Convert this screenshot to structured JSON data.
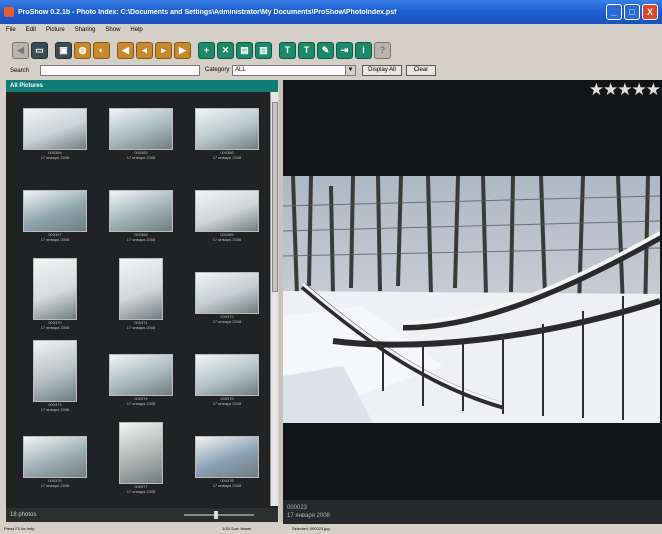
{
  "window": {
    "title": "ProShow 0.2.1b - Photo Index: C:\\Documents and Settings\\Administrator\\My Documents\\ProShow\\PhotoIndex.psf",
    "controls": [
      "_",
      "□",
      "X"
    ]
  },
  "menu": [
    "File",
    "Edit",
    "Picture",
    "Sharing",
    "Show",
    "Help"
  ],
  "toolbar": {
    "buttons": [
      {
        "icon": "nav-first-icon",
        "glyph": "◀",
        "style": "gray"
      },
      {
        "icon": "print-icon",
        "glyph": "▭",
        "style": "dark"
      },
      {
        "icon": "slideshow-icon",
        "glyph": "▣",
        "style": "dark"
      },
      {
        "icon": "zoom-icon",
        "glyph": "◍",
        "style": "orange"
      },
      {
        "icon": "rotate-icon",
        "glyph": "◐",
        "style": "orange"
      },
      {
        "icon": "first-icon",
        "glyph": "◀",
        "style": "orange"
      },
      {
        "icon": "prev-icon",
        "glyph": "◂",
        "style": "orange"
      },
      {
        "icon": "next-icon",
        "glyph": "▸",
        "style": "orange"
      },
      {
        "icon": "last-icon",
        "glyph": "▶",
        "style": "orange"
      },
      {
        "icon": "add-icon",
        "glyph": "+",
        "style": "green"
      },
      {
        "icon": "delete-icon",
        "glyph": "✕",
        "style": "green"
      },
      {
        "icon": "copy-icon",
        "glyph": "▤",
        "style": "green"
      },
      {
        "icon": "move-icon",
        "glyph": "▥",
        "style": "green"
      },
      {
        "icon": "text-icon",
        "glyph": "T",
        "style": "green"
      },
      {
        "icon": "caption-icon",
        "glyph": "T",
        "style": "green"
      },
      {
        "icon": "edit-icon",
        "glyph": "✎",
        "style": "green"
      },
      {
        "icon": "export-icon",
        "glyph": "⇥",
        "style": "green"
      },
      {
        "icon": "info-icon",
        "glyph": "i",
        "style": "green"
      },
      {
        "icon": "help-icon",
        "glyph": "?",
        "style": "gray"
      }
    ]
  },
  "search": {
    "label": "Search",
    "value": "",
    "category_label": "Category",
    "category_value": "ALL",
    "display_all": "Display All",
    "clear": "Clear"
  },
  "panel": {
    "header": "All Pictures",
    "footer": "18 photos",
    "zoom_level": 0.45
  },
  "thumbnails": [
    {
      "id": "000364",
      "date": "17 января 2008",
      "tone": "#c9d3d6",
      "portrait": false
    },
    {
      "id": "000365",
      "date": "17 января 2008",
      "tone": "#a6bac0",
      "portrait": false
    },
    {
      "id": "000366",
      "date": "17 января 2008",
      "tone": "#b9c7c9",
      "portrait": false
    },
    {
      "id": "000367",
      "date": "17 января 2008",
      "tone": "#8ea6ac",
      "portrait": false
    },
    {
      "id": "000368",
      "date": "17 января 2008",
      "tone": "#9fb3b6",
      "portrait": false
    },
    {
      "id": "000369",
      "date": "17 января 2008",
      "tone": "#cfd5d6",
      "portrait": false
    },
    {
      "id": "000370",
      "date": "17 января 2008",
      "tone": "#d8dcdc",
      "portrait": true
    },
    {
      "id": "000371",
      "date": "17 января 2008",
      "tone": "#d5d8d8",
      "portrait": true
    },
    {
      "id": "000372",
      "date": "17 января 2008",
      "tone": "#c4cdd0",
      "portrait": false
    },
    {
      "id": "000373",
      "date": "17 января 2008",
      "tone": "#b7c1c4",
      "portrait": true
    },
    {
      "id": "000374",
      "date": "17 января 2008",
      "tone": "#a9b9bd",
      "portrait": false
    },
    {
      "id": "000375",
      "date": "17 января 2008",
      "tone": "#b3c2c6",
      "portrait": false
    },
    {
      "id": "000376",
      "date": "17 января 2008",
      "tone": "#9db0b5",
      "portrait": false
    },
    {
      "id": "000377",
      "date": "17 января 2008",
      "tone": "#b1b3b1",
      "portrait": true
    },
    {
      "id": "000378",
      "date": "17 января 2008",
      "tone": "#8aa0b4",
      "portrait": false
    }
  ],
  "viewer": {
    "rating": "★★★★★",
    "photo_id": "000023",
    "photo_date": "17 января 2008"
  },
  "statusbar": {
    "left": "Press F1 for help",
    "middle": "1/18    Sort: Name",
    "right": "Selected: 000023.jpg"
  },
  "colors": {
    "accent": "#0f7c75",
    "toolbar_green": "#1b8a6a",
    "toolbar_orange": "#c9892a"
  }
}
